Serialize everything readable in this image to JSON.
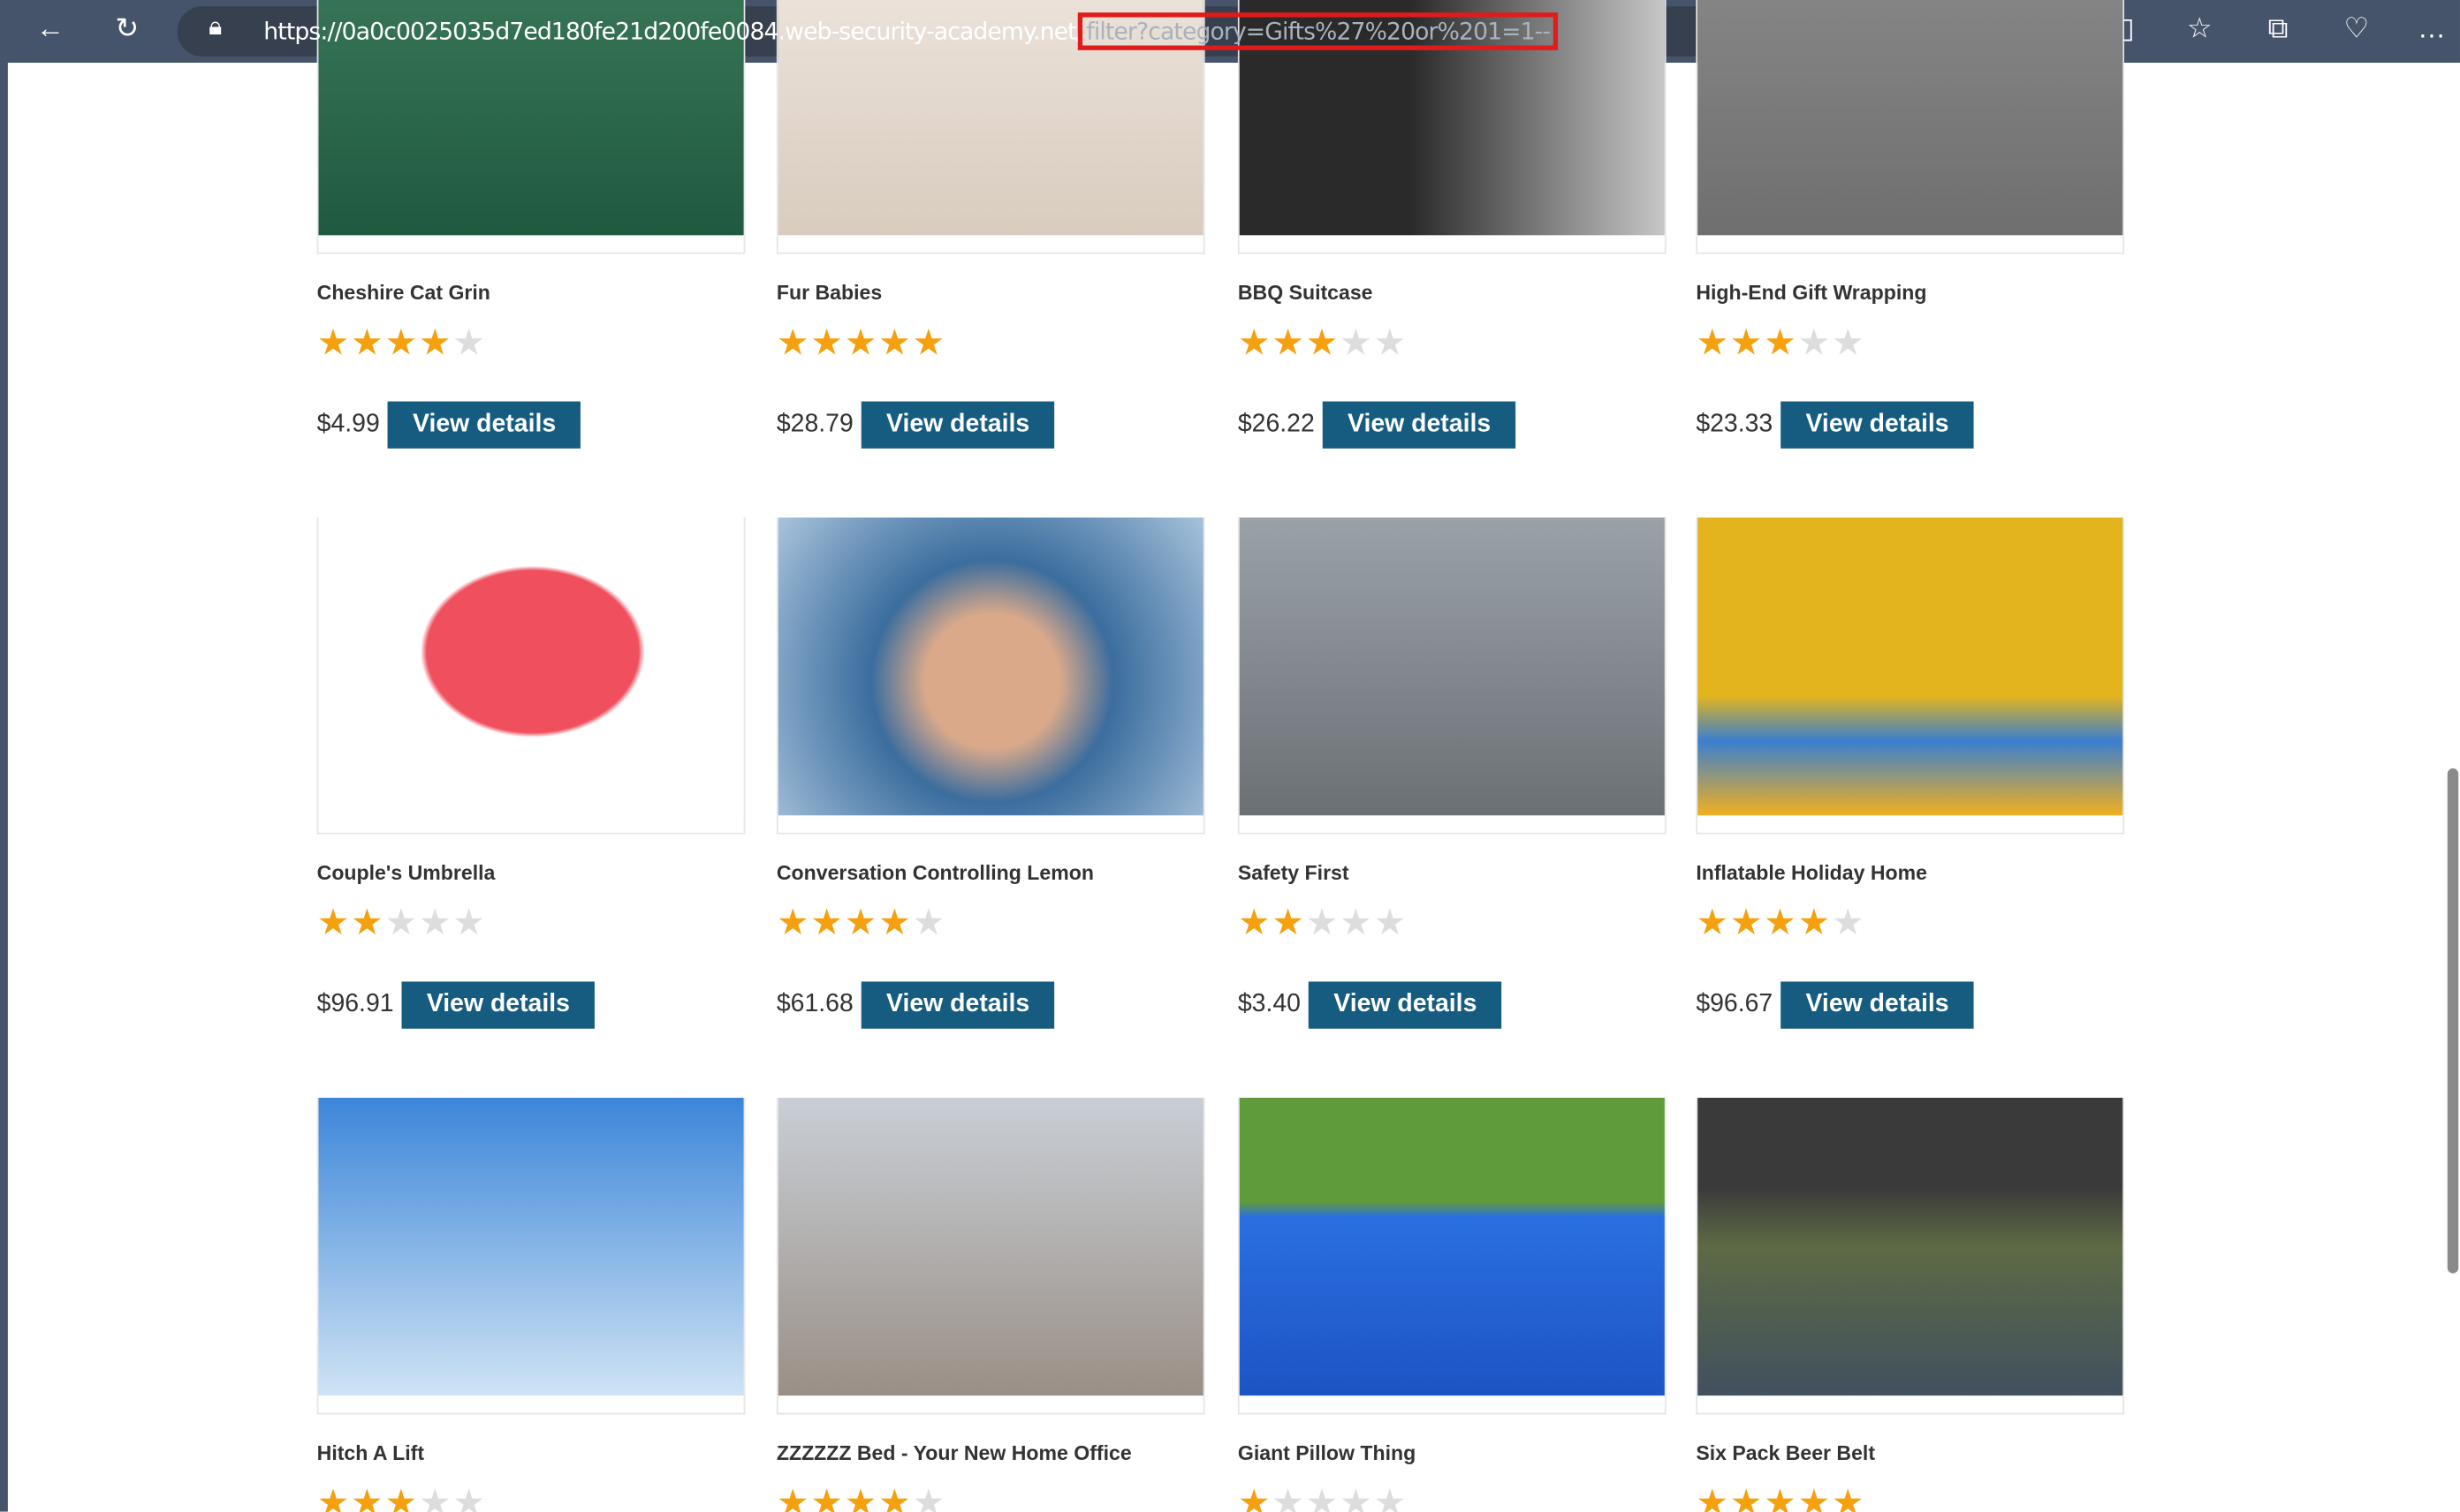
{
  "browser": {
    "url_host": "https://0a0c0025035d7ed180fe21d200fe0084.web-security-academy.net/",
    "url_query": "filter?category=Gifts%27%20or%201=1--"
  },
  "colors": {
    "star": "#f5a00f",
    "button": "#155c80",
    "highlight": "#e01b1b"
  },
  "button_label": "View details",
  "products": [
    {
      "name": "Cheshire Cat Grin",
      "rating": 4,
      "price": "$4.99",
      "img": "linear-gradient(#3d7a5a,#1f5a40)"
    },
    {
      "name": "Fur Babies",
      "rating": 5,
      "price": "$28.79",
      "img": "linear-gradient(#efe7df,#d9ccbf)"
    },
    {
      "name": "BBQ Suitcase",
      "rating": 3,
      "price": "$26.22",
      "img": "linear-gradient(90deg,#2a2a2a 40%,#c9c9c9)"
    },
    {
      "name": "High-End Gift Wrapping",
      "rating": 3,
      "price": "$23.33",
      "img": "linear-gradient(#8a8a8a,#6f6f6f)"
    },
    {
      "name": "Couple's Umbrella",
      "rating": 2,
      "price": "$96.91",
      "img": "radial-gradient(ellipse at 50% 45%,#f0505e 35%,#fff 37%)"
    },
    {
      "name": "Conversation Controlling Lemon",
      "rating": 4,
      "price": "$61.68",
      "img": "radial-gradient(circle at 50% 55%,#d9a98a 25%,#3b6d9e 45%,#a9c4dc)"
    },
    {
      "name": "Safety First",
      "rating": 2,
      "price": "$3.40",
      "img": "linear-gradient(#9aa2a8,#6b7075)"
    },
    {
      "name": "Inflatable Holiday Home",
      "rating": 4,
      "price": "$96.67",
      "img": "linear-gradient(#e3b41e 60%,#3a7fd0 75%,#f0b020)"
    },
    {
      "name": "Hitch A Lift",
      "rating": 3,
      "price": "",
      "img": "linear-gradient(#3c86d8,#cfe3f5)"
    },
    {
      "name": "ZZZZZZ Bed - Your New Home Office",
      "rating": 4,
      "price": "",
      "img": "linear-gradient(#c9cfd6,#9a8f86)"
    },
    {
      "name": "Giant Pillow Thing",
      "rating": 1,
      "price": "",
      "img": "linear-gradient(#5f9b3a 35%,#2a6fe0 40%,#1d54c4)"
    },
    {
      "name": "Six Pack Beer Belt",
      "rating": 5,
      "price": "",
      "img": "linear-gradient(#3a3a3a 30%,#5d6a45 50%,#41505e)"
    }
  ]
}
